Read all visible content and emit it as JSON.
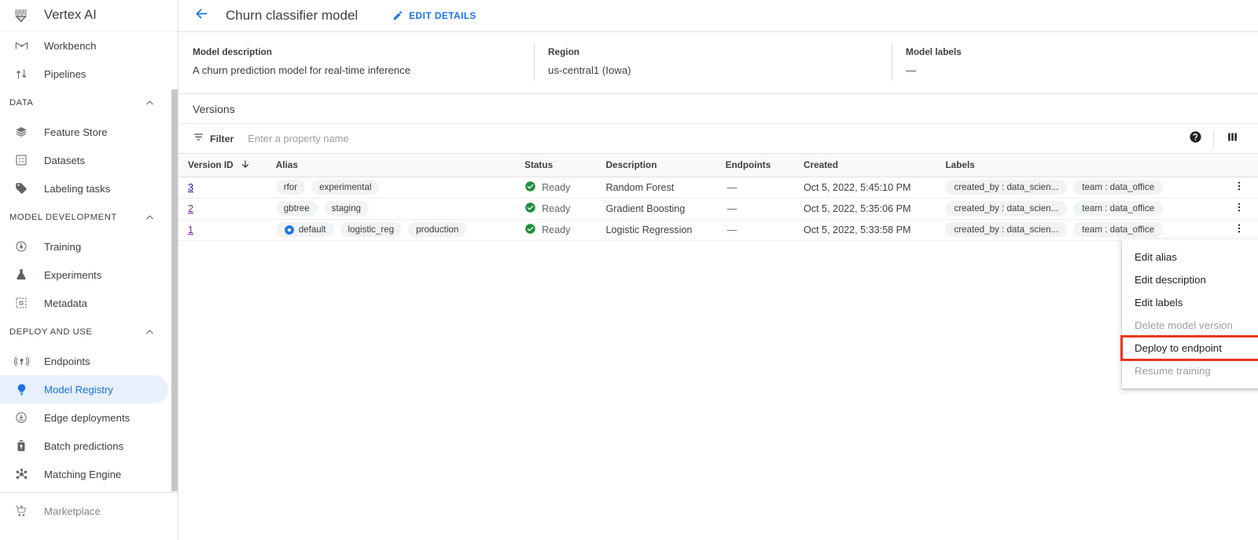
{
  "sidebar": {
    "brand": {
      "title": "Vertex AI",
      "logo_icon": "vertex-ai-logo"
    },
    "top_items": [
      {
        "label": "Workbench",
        "icon": "workbench-icon"
      },
      {
        "label": "Pipelines",
        "icon": "pipelines-icon"
      }
    ],
    "sections": [
      {
        "title": "DATA",
        "collapse_icon": "chevron-up-icon",
        "items": [
          {
            "label": "Feature Store",
            "icon": "feature-store-icon"
          },
          {
            "label": "Datasets",
            "icon": "datasets-icon"
          },
          {
            "label": "Labeling tasks",
            "icon": "labeling-tasks-icon"
          }
        ]
      },
      {
        "title": "MODEL DEVELOPMENT",
        "collapse_icon": "chevron-up-icon",
        "items": [
          {
            "label": "Training",
            "icon": "training-icon"
          },
          {
            "label": "Experiments",
            "icon": "experiments-flask-icon"
          },
          {
            "label": "Metadata",
            "icon": "metadata-icon"
          }
        ]
      },
      {
        "title": "DEPLOY AND USE",
        "collapse_icon": "chevron-up-icon",
        "items": [
          {
            "label": "Endpoints",
            "icon": "endpoints-icon"
          },
          {
            "label": "Model Registry",
            "icon": "model-registry-bulb-icon",
            "selected": true
          },
          {
            "label": "Edge deployments",
            "icon": "edge-deployments-icon"
          },
          {
            "label": "Batch predictions",
            "icon": "batch-predictions-icon"
          },
          {
            "label": "Matching Engine",
            "icon": "matching-engine-icon"
          }
        ]
      }
    ],
    "footer_items": [
      {
        "label": "Marketplace",
        "icon": "marketplace-cart-icon"
      }
    ],
    "accent_selected_bg": "#e8f0fe",
    "accent_selected_text": "#1a73e8"
  },
  "topbar": {
    "back_icon": "arrow-left-icon",
    "title": "Churn classifier model",
    "edit_details_label": "EDIT DETAILS",
    "edit_details_icon": "pencil-icon",
    "accent": "#1a73e8"
  },
  "summary": {
    "columns": [
      {
        "label": "Model description",
        "value": "A churn prediction model for real-time inference"
      },
      {
        "label": "Region",
        "value": "us-central1 (Iowa)"
      },
      {
        "label": "Model labels",
        "value": "—"
      }
    ]
  },
  "versions": {
    "heading": "Versions",
    "filter": {
      "label": "Filter",
      "icon": "filter-icon",
      "placeholder": "Enter a property name",
      "value": ""
    },
    "actions": [
      {
        "icon": "help-icon",
        "name": "help-button"
      },
      {
        "icon": "column-settings-icon",
        "name": "column-settings-button"
      }
    ],
    "columns": [
      {
        "key": "version_id",
        "label": "Version ID",
        "sort_icon": "arrow-down-icon"
      },
      {
        "key": "alias",
        "label": "Alias"
      },
      {
        "key": "status",
        "label": "Status"
      },
      {
        "key": "description",
        "label": "Description"
      },
      {
        "key": "endpoints",
        "label": "Endpoints"
      },
      {
        "key": "created",
        "label": "Created"
      },
      {
        "key": "labels",
        "label": "Labels"
      }
    ],
    "rows": [
      {
        "version_id": "3",
        "link_visited": false,
        "aliases": [
          {
            "text": "rfor"
          },
          {
            "text": "experimental"
          }
        ],
        "status": "Ready",
        "status_icon": "check-circle-icon",
        "description": "Random Forest",
        "endpoints": "—",
        "created": "Oct 5, 2022, 5:45:10 PM",
        "labels": [
          "created_by : data_scien...",
          "team : data_office"
        ],
        "menu_icon": "more-vert-icon"
      },
      {
        "version_id": "2",
        "link_visited": true,
        "aliases": [
          {
            "text": "gbtree"
          },
          {
            "text": "staging"
          }
        ],
        "status": "Ready",
        "status_icon": "check-circle-icon",
        "description": "Gradient Boosting",
        "endpoints": "—",
        "created": "Oct 5, 2022, 5:35:06 PM",
        "labels": [
          "created_by : data_scien...",
          "team : data_office"
        ],
        "menu_icon": "more-vert-icon"
      },
      {
        "version_id": "1",
        "link_visited": true,
        "aliases": [
          {
            "text": "default",
            "icon": "star-circle-icon"
          },
          {
            "text": "logistic_reg"
          },
          {
            "text": "production"
          }
        ],
        "status": "Ready",
        "status_icon": "check-circle-icon",
        "description": "Logistic Regression",
        "endpoints": "—",
        "created": "Oct 5, 2022, 5:33:58 PM",
        "labels": [
          "created_by : data_scien...",
          "team : data_office"
        ],
        "menu_icon": "more-vert-icon"
      }
    ]
  },
  "context_menu": {
    "items": [
      {
        "label": "Edit alias",
        "disabled": false,
        "highlighted": false
      },
      {
        "label": "Edit description",
        "disabled": false,
        "highlighted": false
      },
      {
        "label": "Edit labels",
        "disabled": false,
        "highlighted": false
      },
      {
        "label": "Delete model version",
        "disabled": true,
        "highlighted": false
      },
      {
        "label": "Deploy to endpoint",
        "disabled": false,
        "highlighted": true
      },
      {
        "label": "Resume training",
        "disabled": true,
        "highlighted": false
      }
    ],
    "highlight_color": "#ea3323"
  }
}
